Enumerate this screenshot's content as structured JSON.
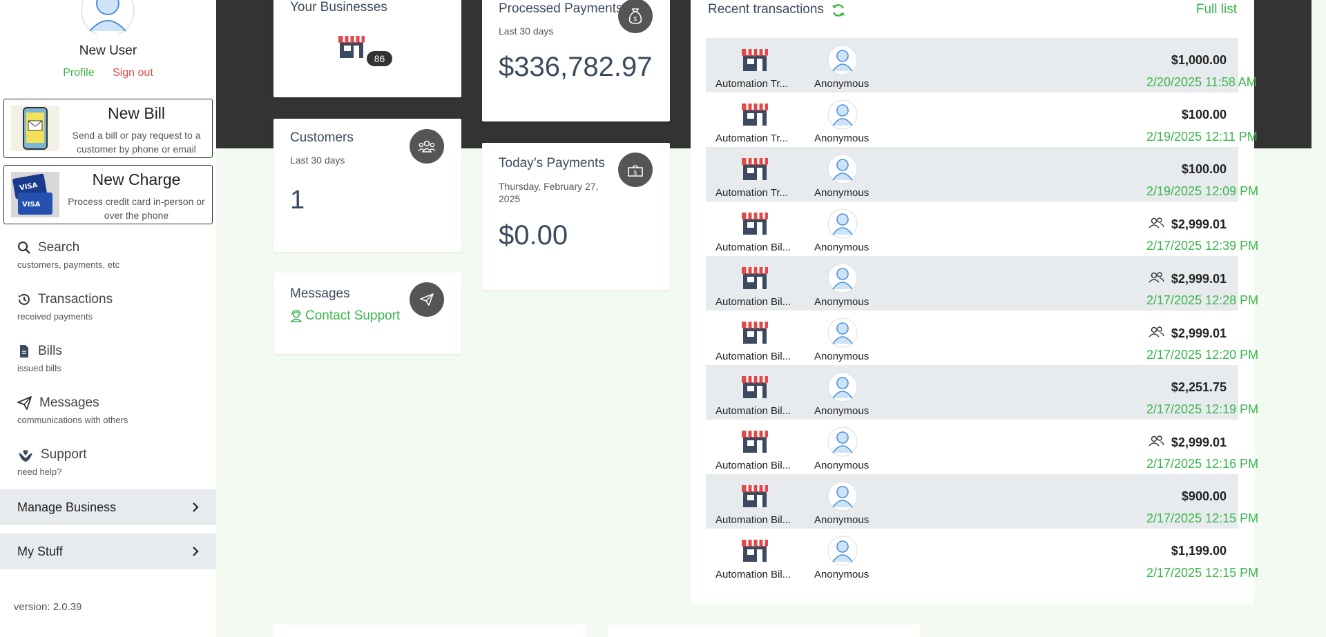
{
  "user": {
    "name": "New User",
    "profile_label": "Profile",
    "signout_label": "Sign out"
  },
  "actions": {
    "new_bill": {
      "title": "New Bill",
      "desc": "Send a bill or pay request to a customer by phone or email"
    },
    "new_charge": {
      "title": "New Charge",
      "desc": "Process credit card in-person or over the phone"
    }
  },
  "nav": [
    {
      "label": "Search",
      "sub": "customers, payments, etc",
      "icon": "search-icon"
    },
    {
      "label": "Transactions",
      "sub": "received payments",
      "icon": "history-icon"
    },
    {
      "label": "Bills",
      "sub": "issued bills",
      "icon": "document-icon"
    },
    {
      "label": "Messages",
      "sub": "communications with others",
      "icon": "paper-plane-icon"
    },
    {
      "label": "Support",
      "sub": "need help?",
      "icon": "support-hands-icon"
    }
  ],
  "groups": {
    "manage_business": "Manage Business",
    "my_stuff": "My Stuff"
  },
  "version": "version: 2.0.39",
  "cards": {
    "businesses": {
      "title": "Your Businesses",
      "count": "86"
    },
    "processed": {
      "title": "Processed Payments",
      "sub": "Last 30 days",
      "value": "$336,782.97"
    },
    "customers": {
      "title": "Customers",
      "sub": "Last 30 days",
      "value": "1"
    },
    "today": {
      "title": "Today’s Payments",
      "sub": "Thursday, February 27, 2025",
      "value": "$0.00"
    },
    "messages": {
      "title": "Messages",
      "link": "Contact Support"
    }
  },
  "transactions": {
    "title": "Recent transactions",
    "full_list": "Full list",
    "rows": [
      {
        "merchant": "Automation Tr...",
        "customer": "Anonymous",
        "amount": "$1,000.00",
        "date": "2/20/2025 11:58 AM",
        "group": false
      },
      {
        "merchant": "Automation Tr...",
        "customer": "Anonymous",
        "amount": "$100.00",
        "date": "2/19/2025 12:11 PM",
        "group": false
      },
      {
        "merchant": "Automation Tr...",
        "customer": "Anonymous",
        "amount": "$100.00",
        "date": "2/19/2025 12:09 PM",
        "group": false
      },
      {
        "merchant": "Automation Bil...",
        "customer": "Anonymous",
        "amount": "$2,999.01",
        "date": "2/17/2025 12:39 PM",
        "group": true
      },
      {
        "merchant": "Automation Bil...",
        "customer": "Anonymous",
        "amount": "$2,999.01",
        "date": "2/17/2025 12:28 PM",
        "group": true
      },
      {
        "merchant": "Automation Bil...",
        "customer": "Anonymous",
        "amount": "$2,999.01",
        "date": "2/17/2025 12:20 PM",
        "group": true
      },
      {
        "merchant": "Automation Bil...",
        "customer": "Anonymous",
        "amount": "$2,251.75",
        "date": "2/17/2025 12:19 PM",
        "group": false
      },
      {
        "merchant": "Automation Bil...",
        "customer": "Anonymous",
        "amount": "$2,999.01",
        "date": "2/17/2025 12:16 PM",
        "group": true
      },
      {
        "merchant": "Automation Bil...",
        "customer": "Anonymous",
        "amount": "$900.00",
        "date": "2/17/2025 12:15 PM",
        "group": false
      },
      {
        "merchant": "Automation Bil...",
        "customer": "Anonymous",
        "amount": "$1,199.00",
        "date": "2/17/2025 12:15 PM",
        "group": false
      }
    ]
  },
  "colors": {
    "accent_green": "#3ab54a",
    "danger_red": "#e24a4a",
    "header_dark": "#333333",
    "row_shade": "#e8ebee"
  }
}
